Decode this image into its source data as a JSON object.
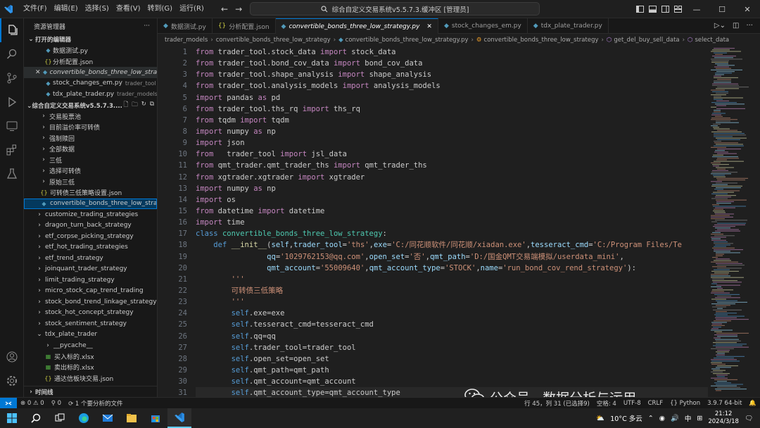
{
  "titlebar": {
    "menus": [
      "文件(F)",
      "编辑(E)",
      "选择(S)",
      "查看(V)",
      "转到(G)",
      "运行(R)"
    ],
    "center_title": "综合自定义交易系统v5.5.7.3.缓冲区 [管理员]"
  },
  "sidebar": {
    "title": "资源管理器",
    "open_editors_header": "打开的编辑器",
    "open_editors": [
      {
        "icon": "python-icon",
        "label": "数据测试.py",
        "hint": ""
      },
      {
        "icon": "json-icon",
        "label": "分析配置.json",
        "hint": ""
      },
      {
        "icon": "python-icon",
        "label": "convertible_bonds_three_low_strate...",
        "hint": ""
      },
      {
        "icon": "python-icon",
        "label": "stock_changes_em.py",
        "hint": "trader_tool"
      },
      {
        "icon": "python-icon",
        "label": "tdx_plate_trader.py",
        "hint": "trader_models\\..."
      }
    ],
    "workspace_header": "综合自定义交易系统v5.5.7.3....",
    "tree": [
      {
        "label": "交易股票池",
        "type": "folder"
      },
      {
        "label": "目前溢价率可转债",
        "type": "folder"
      },
      {
        "label": "强制赎回",
        "type": "folder"
      },
      {
        "label": "全部数据",
        "type": "folder"
      },
      {
        "label": "三低",
        "type": "folder"
      },
      {
        "label": "选择可转债",
        "type": "folder"
      },
      {
        "label": "原始三低",
        "type": "folder"
      },
      {
        "label": "可转债三低策略设置.json",
        "type": "json"
      },
      {
        "label": "convertible_bonds_three_low_strate...",
        "type": "py",
        "selected": true
      },
      {
        "label": "customize_trading_strategies",
        "type": "folder"
      },
      {
        "label": "dragon_turn_back_strategy",
        "type": "folder"
      },
      {
        "label": "etf_corpse_picking_strategy",
        "type": "folder"
      },
      {
        "label": "etf_hot_trading_strategies",
        "type": "folder"
      },
      {
        "label": "etf_trend_strategy",
        "type": "folder"
      },
      {
        "label": "joinquant_trader_strategy",
        "type": "folder"
      },
      {
        "label": "limit_trading_strategy",
        "type": "folder"
      },
      {
        "label": "micro_stock_cap_trend_trading",
        "type": "folder"
      },
      {
        "label": "stock_bond_trend_linkage_strategy",
        "type": "folder"
      },
      {
        "label": "stock_hot_concept_strategy",
        "type": "folder"
      },
      {
        "label": "stock_sentiment_strategy",
        "type": "folder"
      },
      {
        "label": "tdx_plate_trader",
        "type": "folder-open"
      },
      {
        "label": "__pycache__",
        "type": "folder"
      },
      {
        "label": "买入标的.xlsx",
        "type": "xlsx"
      },
      {
        "label": "卖出标的.xlsx",
        "type": "xlsx"
      },
      {
        "label": "通达信板块交易.json",
        "type": "json"
      }
    ],
    "timeline_header": "时间线"
  },
  "tabs": [
    {
      "label": "数据测试.py",
      "icon": "python-icon"
    },
    {
      "label": "分析配置.json",
      "icon": "json-icon"
    },
    {
      "label": "convertible_bonds_three_low_strategy.py",
      "icon": "python-icon",
      "active": true
    },
    {
      "label": "stock_changes_em.py",
      "icon": "python-icon"
    },
    {
      "label": "tdx_plate_trader.py",
      "icon": "python-icon"
    }
  ],
  "breadcrumb": [
    "trader_models",
    "convertible_bonds_three_low_strategy",
    "convertible_bonds_three_low_strategy.py",
    "convertible_bonds_three_low_strategy",
    "get_del_buy_sell_data",
    "select_data"
  ],
  "editor": {
    "line_numbers": [
      "1",
      "2",
      "3",
      "4",
      "5",
      "6",
      "7",
      "8",
      "9",
      "10",
      "11",
      "12",
      "13",
      "14",
      "15",
      "16",
      "17",
      "18",
      "19",
      "20",
      "21",
      "22",
      "23",
      "24",
      "25",
      "26",
      "27",
      "28",
      "29",
      "30",
      "31"
    ],
    "lines": [
      [
        [
          "kw2",
          "from "
        ],
        [
          "",
          "trader_tool.stock_data "
        ],
        [
          "kw2",
          "import "
        ],
        [
          "",
          "stock_data"
        ]
      ],
      [
        [
          "kw2",
          "from "
        ],
        [
          "",
          "trader_tool.bond_cov_data "
        ],
        [
          "kw2",
          "import "
        ],
        [
          "",
          "bond_cov_data"
        ]
      ],
      [
        [
          "kw2",
          "from "
        ],
        [
          "",
          "trader_tool.shape_analysis "
        ],
        [
          "kw2",
          "import "
        ],
        [
          "",
          "shape_analysis"
        ]
      ],
      [
        [
          "kw2",
          "from "
        ],
        [
          "",
          "trader_tool.analysis_models "
        ],
        [
          "kw2",
          "import "
        ],
        [
          "",
          "analysis_models"
        ]
      ],
      [
        [
          "kw2",
          "import "
        ],
        [
          "",
          "pandas "
        ],
        [
          "kw2",
          "as "
        ],
        [
          "",
          "pd"
        ]
      ],
      [
        [
          "kw2",
          "from "
        ],
        [
          "",
          "trader_tool.ths_rq "
        ],
        [
          "kw2",
          "import "
        ],
        [
          "",
          "ths_rq"
        ]
      ],
      [
        [
          "kw2",
          "from "
        ],
        [
          "",
          "tqdm "
        ],
        [
          "kw2",
          "import "
        ],
        [
          "",
          "tqdm"
        ]
      ],
      [
        [
          "kw2",
          "import "
        ],
        [
          "",
          "numpy "
        ],
        [
          "kw2",
          "as "
        ],
        [
          "",
          "np"
        ]
      ],
      [
        [
          "kw2",
          "import "
        ],
        [
          "",
          "json"
        ]
      ],
      [
        [
          "kw2",
          "from "
        ],
        [
          "",
          "  trader_tool "
        ],
        [
          "kw2",
          "import "
        ],
        [
          "",
          "jsl_data"
        ]
      ],
      [
        [
          "kw2",
          "from "
        ],
        [
          "",
          "qmt_trader.qmt_trader_ths "
        ],
        [
          "kw2",
          "import "
        ],
        [
          "",
          "qmt_trader_ths"
        ]
      ],
      [
        [
          "kw2",
          "from "
        ],
        [
          "",
          "xgtrader.xgtrader "
        ],
        [
          "kw2",
          "import "
        ],
        [
          "",
          "xgtrader"
        ]
      ],
      [
        [
          "kw2",
          "import "
        ],
        [
          "",
          "numpy "
        ],
        [
          "kw2",
          "as "
        ],
        [
          "",
          "np"
        ]
      ],
      [
        [
          "kw2",
          "import "
        ],
        [
          "",
          "os"
        ]
      ],
      [
        [
          "kw2",
          "from "
        ],
        [
          "",
          "datetime "
        ],
        [
          "kw2",
          "import "
        ],
        [
          "",
          "datetime"
        ]
      ],
      [
        [
          "kw2",
          "import "
        ],
        [
          "",
          "time"
        ]
      ],
      [
        [
          "kw",
          "class "
        ],
        [
          "cls",
          "convertible_bonds_three_low_strategy"
        ],
        [
          "",
          ":"
        ]
      ],
      [
        [
          "",
          "    "
        ],
        [
          "kw",
          "def "
        ],
        [
          "fn",
          "__init__"
        ],
        [
          "",
          "("
        ],
        [
          "prm",
          "self"
        ],
        [
          "",
          ","
        ],
        [
          "prm",
          "trader_tool"
        ],
        [
          "",
          "="
        ],
        [
          "st",
          "'ths'"
        ],
        [
          "",
          ","
        ],
        [
          "prm",
          "exe"
        ],
        [
          "",
          "="
        ],
        [
          "st",
          "'C:/同花顺软件/同花顺/xiadan.exe'"
        ],
        [
          "",
          ","
        ],
        [
          "prm",
          "tesseract_cmd"
        ],
        [
          "",
          "="
        ],
        [
          "st",
          "'C:/Program Files/Te"
        ]
      ],
      [
        [
          "",
          "                "
        ],
        [
          "prm",
          "qq"
        ],
        [
          "",
          "="
        ],
        [
          "st",
          "'1029762153@qq.com'"
        ],
        [
          "",
          ","
        ],
        [
          "prm",
          "open_set"
        ],
        [
          "",
          "="
        ],
        [
          "st",
          "'否'"
        ],
        [
          "",
          ","
        ],
        [
          "prm",
          "qmt_path"
        ],
        [
          "",
          "="
        ],
        [
          "st",
          "'D:/国金QMT交易端模拟/userdata_mini'"
        ],
        [
          "",
          ","
        ]
      ],
      [
        [
          "",
          "                "
        ],
        [
          "prm",
          "qmt_account"
        ],
        [
          "",
          "="
        ],
        [
          "st",
          "'55009640'"
        ],
        [
          "",
          ","
        ],
        [
          "prm",
          "qmt_account_type"
        ],
        [
          "",
          "="
        ],
        [
          "st",
          "'STOCK'"
        ],
        [
          "",
          ","
        ],
        [
          "prm",
          "name"
        ],
        [
          "",
          "="
        ],
        [
          "st",
          "'run_bond_cov_rend_strategy'"
        ],
        [
          "",
          "):"
        ]
      ],
      [
        [
          "",
          "        "
        ],
        [
          "st",
          "'''"
        ]
      ],
      [
        [
          "",
          "        "
        ],
        [
          "st",
          "可转债三低策略"
        ]
      ],
      [
        [
          "",
          "        "
        ],
        [
          "st",
          "'''"
        ]
      ],
      [
        [
          "",
          "        "
        ],
        [
          "self",
          "self"
        ],
        [
          "",
          ".exe=exe"
        ]
      ],
      [
        [
          "",
          "        "
        ],
        [
          "self",
          "self"
        ],
        [
          "",
          ".tesseract_cmd=tesseract_cmd"
        ]
      ],
      [
        [
          "",
          "        "
        ],
        [
          "self",
          "self"
        ],
        [
          "",
          ".qq=qq"
        ]
      ],
      [
        [
          "",
          "        "
        ],
        [
          "self",
          "self"
        ],
        [
          "",
          ".trader_tool=trader_tool"
        ]
      ],
      [
        [
          "",
          "        "
        ],
        [
          "self",
          "self"
        ],
        [
          "",
          ".open_set=open_set"
        ]
      ],
      [
        [
          "",
          "        "
        ],
        [
          "self",
          "self"
        ],
        [
          "",
          ".qmt_path=qmt_path"
        ]
      ],
      [
        [
          "",
          "        "
        ],
        [
          "self",
          "self"
        ],
        [
          "",
          ".qmt_account=qmt_account"
        ]
      ],
      [
        [
          "",
          "        "
        ],
        [
          "self",
          "self"
        ],
        [
          "",
          ".qmt_account_type=qmt_account_type"
        ]
      ]
    ]
  },
  "watermark": "公众号 · 数据分析与运用",
  "statusbar": {
    "errors": "0",
    "warnings": "0",
    "ports": "0",
    "analysis": "1 个要分析的文件",
    "position": "行 45，列 31 (已选择9)",
    "spaces": "空格: 4",
    "encoding": "UTF-8",
    "eol": "CRLF",
    "language": "Python",
    "version": "3.9.7 64-bit"
  },
  "taskbar": {
    "weather": "10°C 多云",
    "ime": "中",
    "time": "21:12",
    "date": "2024/3/18"
  },
  "colors": {
    "accent": "#0078d4",
    "selection": "#04395e"
  }
}
